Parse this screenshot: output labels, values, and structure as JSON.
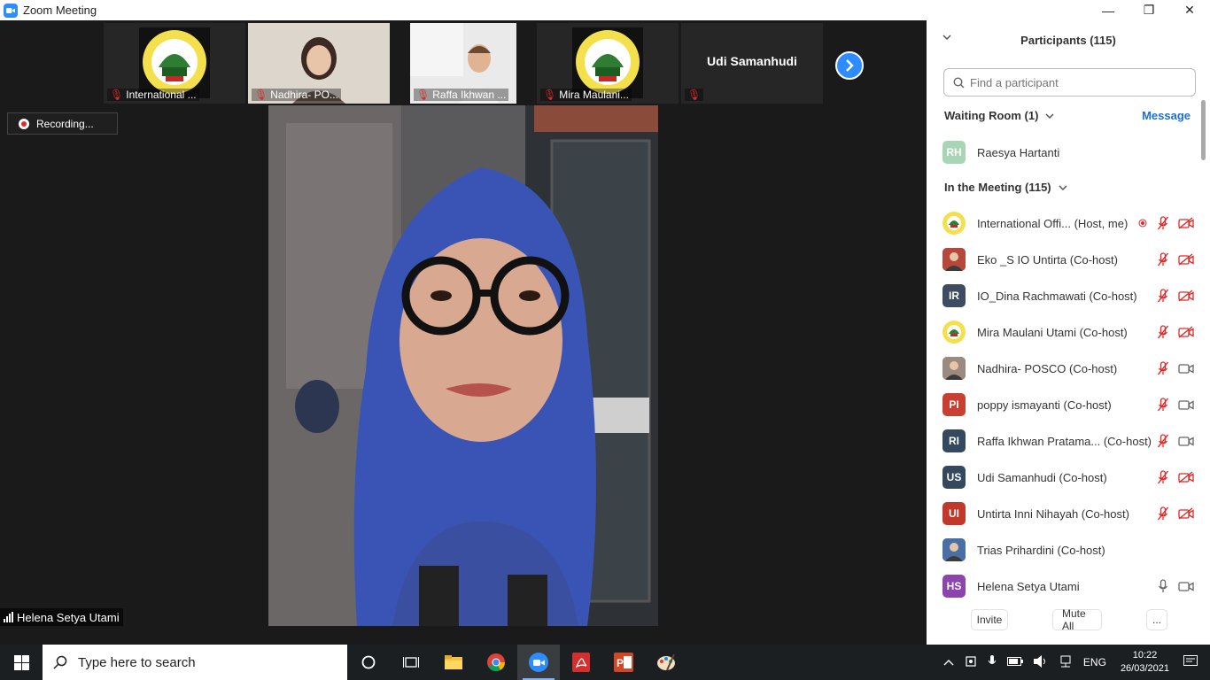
{
  "window": {
    "title": "Zoom Meeting",
    "controls": {
      "minimize": "—",
      "maximize": "❐",
      "close": "✕"
    }
  },
  "thumbnails": [
    {
      "label": "International ...",
      "type": "logo"
    },
    {
      "label": "Nadhira- PO...",
      "type": "video"
    },
    {
      "label": "Raffa Ikhwan ...",
      "type": "video"
    },
    {
      "label": "Mira Maulani...",
      "type": "logo"
    },
    {
      "label": "",
      "name": "Udi Samanhudi",
      "type": "name"
    }
  ],
  "recording": {
    "label": "Recording..."
  },
  "active_speaker": {
    "name": "Helena Setya Utami"
  },
  "panel": {
    "title": "Participants (115)",
    "search_placeholder": "Find a participant",
    "waiting_room": {
      "label": "Waiting Room (1)",
      "message": "Message"
    },
    "waiting": [
      {
        "initials": "RH",
        "name": "Raesya Hartanti",
        "color": "#a8d5b5"
      }
    ],
    "in_meeting_label": "In the Meeting (115)",
    "participants": [
      {
        "name": "International Offi... (Host, me)",
        "avatar": "logo",
        "initials": "",
        "color": "#f4e04d",
        "mic": "muted",
        "video": "off",
        "recording": true
      },
      {
        "name": "Eko _S IO Untirta (Co-host)",
        "avatar": "photo",
        "initials": "",
        "color": "#b5483a",
        "mic": "muted",
        "video": "off"
      },
      {
        "name": "IO_Dina Rachmawati (Co-host)",
        "avatar": "initials",
        "initials": "IR",
        "color": "#3d4c63",
        "mic": "muted",
        "video": "off"
      },
      {
        "name": "Mira Maulani Utami (Co-host)",
        "avatar": "logo",
        "initials": "",
        "color": "#f4e04d",
        "mic": "muted",
        "video": "off"
      },
      {
        "name": "Nadhira- POSCO (Co-host)",
        "avatar": "photo",
        "initials": "",
        "color": "#9a8a80",
        "mic": "muted",
        "video": "on"
      },
      {
        "name": "poppy ismayanti (Co-host)",
        "avatar": "initials",
        "initials": "PI",
        "color": "#c94032",
        "mic": "muted",
        "video": "on"
      },
      {
        "name": "Raffa Ikhwan Pratama... (Co-host)",
        "avatar": "initials",
        "initials": "RI",
        "color": "#34495e",
        "mic": "muted",
        "video": "on"
      },
      {
        "name": "Udi Samanhudi (Co-host)",
        "avatar": "initials",
        "initials": "US",
        "color": "#34495e",
        "mic": "muted",
        "video": "off"
      },
      {
        "name": "Untirta Inni Nihayah (Co-host)",
        "avatar": "initials",
        "initials": "UI",
        "color": "#c0392b",
        "mic": "muted",
        "video": "off"
      },
      {
        "name": "Trias Prihardini (Co-host)",
        "avatar": "photo",
        "initials": "",
        "color": "#4a6fa5",
        "mic": "none",
        "video": "none"
      },
      {
        "name": "Helena Setya Utami",
        "avatar": "initials",
        "initials": "HS",
        "color": "#8e44ad",
        "mic": "on",
        "video": "on"
      }
    ],
    "footer": {
      "invite": "Invite",
      "mute_all": "Mute All",
      "more": "..."
    }
  },
  "taskbar": {
    "search_placeholder": "Type here to search",
    "language": "ENG",
    "time": "10:22",
    "date": "26/03/2021"
  }
}
